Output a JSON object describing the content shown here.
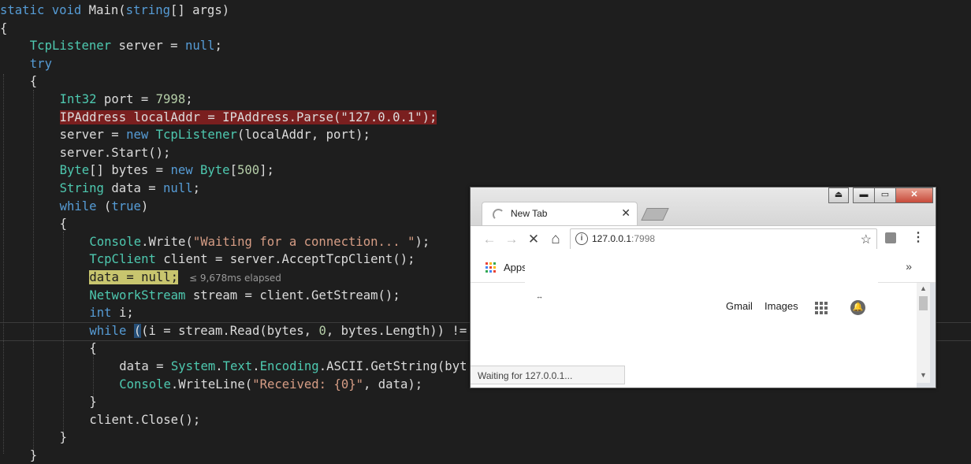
{
  "editor": {
    "lines": [
      {
        "indent": 0,
        "tokens": [
          [
            "kw",
            "static"
          ],
          [
            "id",
            " "
          ],
          [
            "kw",
            "void"
          ],
          [
            "id",
            " Main("
          ],
          [
            "kw",
            "string"
          ],
          [
            "id",
            "[] args)"
          ]
        ]
      },
      {
        "indent": 0,
        "tokens": [
          [
            "id",
            "{"
          ]
        ]
      },
      {
        "indent": 1,
        "tokens": [
          [
            "type",
            "TcpListener"
          ],
          [
            "id",
            " server = "
          ],
          [
            "kw",
            "null"
          ],
          [
            "id",
            ";"
          ]
        ]
      },
      {
        "indent": 1,
        "tokens": [
          [
            "kw",
            "try"
          ]
        ]
      },
      {
        "indent": 1,
        "tokens": [
          [
            "id",
            "{"
          ]
        ]
      },
      {
        "indent": 2,
        "tokens": [
          [
            "type",
            "Int32"
          ],
          [
            "id",
            " port = "
          ],
          [
            "num",
            "7998"
          ],
          [
            "id",
            ";"
          ]
        ]
      },
      {
        "indent": 2,
        "tokens": [
          [
            "id",
            "IPAddress localAddr = IPAddress.Parse(\"127.0.0.1\");"
          ]
        ],
        "breakpoint": true
      },
      {
        "indent": 2,
        "tokens": [
          [
            "id",
            "server = "
          ],
          [
            "kw",
            "new"
          ],
          [
            "id",
            " "
          ],
          [
            "type",
            "TcpListener"
          ],
          [
            "id",
            "(localAddr, port);"
          ]
        ]
      },
      {
        "indent": 2,
        "tokens": [
          [
            "id",
            "server.Start();"
          ]
        ]
      },
      {
        "indent": 2,
        "tokens": [
          [
            "type",
            "Byte"
          ],
          [
            "id",
            "[] bytes = "
          ],
          [
            "kw",
            "new"
          ],
          [
            "id",
            " "
          ],
          [
            "type",
            "Byte"
          ],
          [
            "id",
            "["
          ],
          [
            "num",
            "500"
          ],
          [
            "id",
            "];"
          ]
        ]
      },
      {
        "indent": 2,
        "tokens": [
          [
            "type",
            "String"
          ],
          [
            "id",
            " data = "
          ],
          [
            "kw",
            "null"
          ],
          [
            "id",
            ";"
          ]
        ]
      },
      {
        "indent": 2,
        "tokens": [
          [
            "kw",
            "while"
          ],
          [
            "id",
            " ("
          ],
          [
            "kw",
            "true"
          ],
          [
            "id",
            ")"
          ]
        ]
      },
      {
        "indent": 2,
        "tokens": [
          [
            "id",
            "{"
          ]
        ]
      },
      {
        "indent": 3,
        "tokens": [
          [
            "type",
            "Console"
          ],
          [
            "id",
            ".Write("
          ],
          [
            "str",
            "\"Waiting for a connection... \""
          ],
          [
            "id",
            ");"
          ]
        ]
      },
      {
        "indent": 3,
        "tokens": [
          [
            "type",
            "TcpClient"
          ],
          [
            "id",
            " client = server.AcceptTcpClient();"
          ]
        ]
      },
      {
        "indent": 3,
        "tokens": [
          [
            "id",
            "data = null;"
          ]
        ],
        "current": true
      },
      {
        "indent": 3,
        "tokens": [
          [
            "type",
            "NetworkStream"
          ],
          [
            "id",
            " stream = client.GetStream();"
          ]
        ]
      },
      {
        "indent": 3,
        "tokens": [
          [
            "kw",
            "int"
          ],
          [
            "id",
            " i;"
          ]
        ]
      },
      {
        "indent": 3,
        "tokens": [
          [
            "kw",
            "while"
          ],
          [
            "id",
            " "
          ],
          [
            "bracket",
            "("
          ],
          [
            "id",
            "(i = stream.Read(bytes, "
          ],
          [
            "num",
            "0"
          ],
          [
            "id",
            ", bytes.Length)) !="
          ]
        ]
      },
      {
        "indent": 3,
        "tokens": [
          [
            "id",
            "{"
          ]
        ]
      },
      {
        "indent": 4,
        "tokens": [
          [
            "id",
            "data = "
          ],
          [
            "type",
            "System"
          ],
          [
            "id",
            "."
          ],
          [
            "type",
            "Text"
          ],
          [
            "id",
            "."
          ],
          [
            "type",
            "Encoding"
          ],
          [
            "id",
            ".ASCII.GetString(byt"
          ]
        ]
      },
      {
        "indent": 4,
        "tokens": [
          [
            "type",
            "Console"
          ],
          [
            "id",
            ".WriteLine("
          ],
          [
            "str",
            "\"Received: {0}\""
          ],
          [
            "id",
            ", data);"
          ]
        ]
      },
      {
        "indent": 3,
        "tokens": [
          [
            "id",
            "}"
          ]
        ]
      },
      {
        "indent": 3,
        "tokens": [
          [
            "id",
            "client.Close();"
          ]
        ]
      },
      {
        "indent": 2,
        "tokens": [
          [
            "id",
            "}"
          ]
        ]
      },
      {
        "indent": 1,
        "tokens": [
          [
            "id",
            "}"
          ]
        ]
      }
    ],
    "perf_tip": "≤ 9,678ms elapsed"
  },
  "browser": {
    "tab_title": "New Tab",
    "tab_close": "✕",
    "window_buttons": {
      "profile": "⏏",
      "minimize": "▬",
      "maximize": "▭",
      "close": "✕"
    },
    "nav": {
      "back": "←",
      "forward": "→",
      "stop": "✕",
      "home": "⌂"
    },
    "omnibox": {
      "host": "127.0.0.1",
      "port": ":7998",
      "info": "i",
      "star": "☆"
    },
    "menu": "⋮",
    "bookmarks": {
      "apps_label": "Apps",
      "overflow": "»"
    },
    "content": {
      "gmail": "Gmail",
      "images": "Images",
      "mark": "↔"
    },
    "status": "Waiting for 127.0.0.1...",
    "scroll": {
      "up": "▲",
      "down": "▼"
    }
  },
  "colors": {
    "breakpoint": "#7a1f1f",
    "current_line": "#c8c56e",
    "keyword": "#569cd6",
    "type": "#4ec9b0",
    "string": "#d69d85",
    "number": "#b5cea8"
  }
}
